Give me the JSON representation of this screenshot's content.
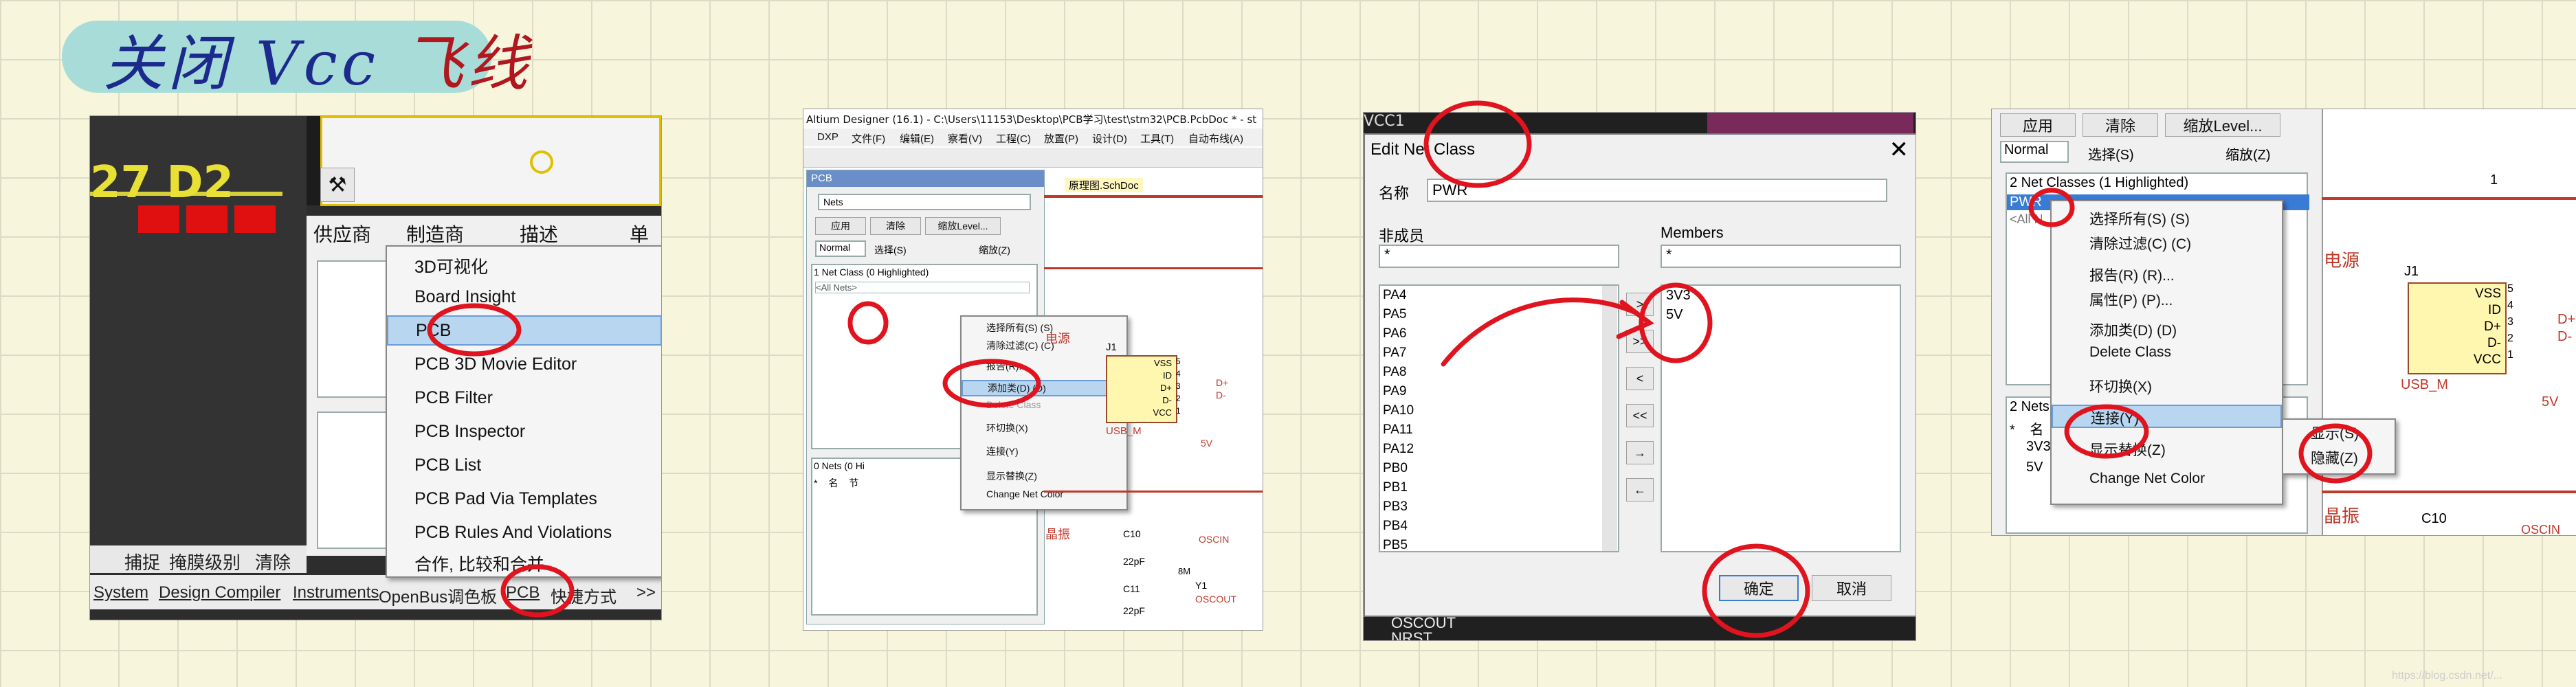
{
  "title": {
    "part1": "关闭 Vcc",
    "part2": "飞线"
  },
  "panel1": {
    "pcb_label": "27 D2",
    "columns": [
      "供应商",
      "制造商",
      "描述",
      "单"
    ],
    "menu": [
      "3D可视化",
      "Board Insight",
      "PCB",
      "PCB 3D Movie Editor",
      "PCB Filter",
      "PCB Inspector",
      "PCB List",
      "PCB Pad Via Templates",
      "PCB Rules And Violations",
      "合作, 比较和合并"
    ],
    "left_tools": [
      "捕捉",
      "掩膜级别",
      "清除"
    ],
    "status_tabs": [
      "System",
      "Design Compiler",
      "Instruments",
      "OpenBus调色板",
      "PCB",
      "快捷方式",
      ">>"
    ]
  },
  "panel2": {
    "titlebar": "Altium Designer (16.1) - C:\\Users\\11153\\Desktop\\PCB学习\\test\\stm32\\PCB.PcbDoc * - st",
    "menubar": [
      "DXP",
      "文件(F)",
      "编辑(E)",
      "察看(V)",
      "工程(C)",
      "放置(P)",
      "设计(D)",
      "工具(T)",
      "自动布线(A)"
    ],
    "panel_title": "PCB",
    "dropdown": "Nets",
    "buttons": [
      "应用",
      "清除",
      "缩放Level..."
    ],
    "mode": "Normal",
    "chk_select": "选择(S)",
    "chk_zoom": "缩放(Z)",
    "class_header": "1 Net Class (0 Highlighted)",
    "all_nets": "<All Nets>",
    "nets_header": "0 Nets (0 Hi",
    "cols": [
      "*",
      "名",
      "节"
    ],
    "doc_tab": "原理图.SchDoc",
    "menu": [
      "选择所有(S) (S)",
      "清除过滤(C) (C)",
      "报告(R)...",
      "添加类(D) (D)",
      "Delete Class",
      "环切换(X)",
      "连接(Y)",
      "显示替换(Z)",
      "Change Net Color"
    ],
    "sch": {
      "power": "电源",
      "ref": "J1",
      "pins": [
        "VSS",
        "ID",
        "D+",
        "D-",
        "VCC"
      ],
      "pin_nums": [
        "5",
        "4",
        "3",
        "2",
        "1"
      ],
      "net_dp": "D+",
      "net_dm": "D-",
      "part": "USB_M",
      "v5": "5V",
      "crystal": "晶振",
      "c10": "C10",
      "c11": "C11",
      "cap": "22pF",
      "y1": "Y1",
      "osc_in": "OSCIN",
      "osc_out": "OSCOUT",
      "mhz": "8M"
    }
  },
  "panel3": {
    "top_label": "VCC1",
    "dialog_title": "Edit Net Class",
    "name_label": "名称",
    "name_value": "PWR",
    "nonmember_label": "非成员",
    "members_label": "Members",
    "filter": "*",
    "nonmembers": [
      "PA4",
      "PA5",
      "PA6",
      "PA7",
      "PA8",
      "PA9",
      "PA10",
      "PA11",
      "PA12",
      "PB0",
      "PB1",
      "PB3",
      "PB4",
      "PB5"
    ],
    "members": [
      "3V3",
      "5V"
    ],
    "arrows": [
      ">",
      ">>",
      "<",
      "<<",
      "→",
      "←"
    ],
    "ok": "确定",
    "cancel": "取消",
    "bottom": [
      "OSCOUT",
      "NRST"
    ]
  },
  "panel4": {
    "buttons": [
      "应用",
      "清除",
      "缩放Level..."
    ],
    "mode": "Normal",
    "chk_select": "选择(S)",
    "chk_zoom": "缩放(Z)",
    "class_header": "2 Net Classes (1 Highlighted)",
    "pwr": "PWR",
    "all_nets": "<All N",
    "nets_header": "2 Nets",
    "cols": [
      "*",
      "名"
    ],
    "nets": [
      "3V3",
      "5V"
    ],
    "menu": [
      "选择所有(S) (S)",
      "清除过滤(C) (C)",
      "报告(R) (R)...",
      "属性(P) (P)...",
      "添加类(D) (D)",
      "Delete Class",
      "环切换(X)",
      "连接(Y)",
      "显示替换(Z)",
      "Change Net Color"
    ],
    "submenu": [
      "显示(S)",
      "隐藏(Z)"
    ],
    "sch": {
      "page": "1",
      "power": "电源",
      "ref": "J1",
      "pins": [
        "VSS",
        "ID",
        "D+",
        "D-",
        "VCC"
      ],
      "pin_nums": [
        "5",
        "4",
        "3",
        "2",
        "1"
      ],
      "net_dp": "D+",
      "net_dm": "D-",
      "part": "USB_M",
      "v5": "5V",
      "crystal": "晶振",
      "c10": "C10",
      "osc_in": "OSCIN"
    }
  },
  "watermark": "https://blog.csdn.net/..."
}
